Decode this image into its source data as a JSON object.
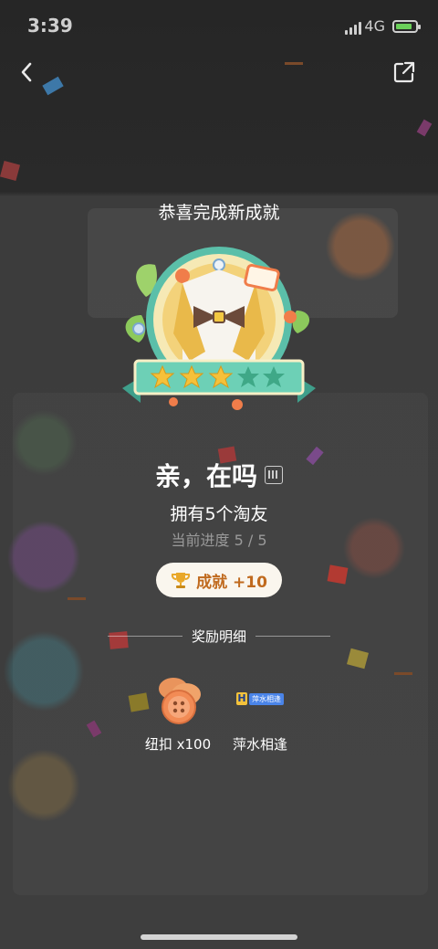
{
  "status_bar": {
    "time": "3:39",
    "network": "4G"
  },
  "header": {
    "back_icon": "chevron-left-icon",
    "share_icon": "share-external-icon"
  },
  "title": "恭喜完成新成就",
  "achievement": {
    "name": "亲，在吗",
    "description": "拥有5个淘友",
    "progress": "当前进度 5 / 5",
    "stars_filled": 3,
    "stars_total": 5
  },
  "reward_pill": {
    "icon": "trophy-icon",
    "label": "成就 +10"
  },
  "rewards_section": {
    "heading": "奖励明细",
    "items": [
      {
        "label": "纽扣 x100",
        "icon": "buttons-icon"
      },
      {
        "label": "萍水相逢",
        "icon": "title-tag-icon",
        "tag_text": "萍水相逢"
      }
    ]
  },
  "colors": {
    "accent": "#c06a1e",
    "pill_bg": "#faf6ee",
    "badge_ring": "#4fb7a3",
    "badge_gold": "#f3c842"
  }
}
